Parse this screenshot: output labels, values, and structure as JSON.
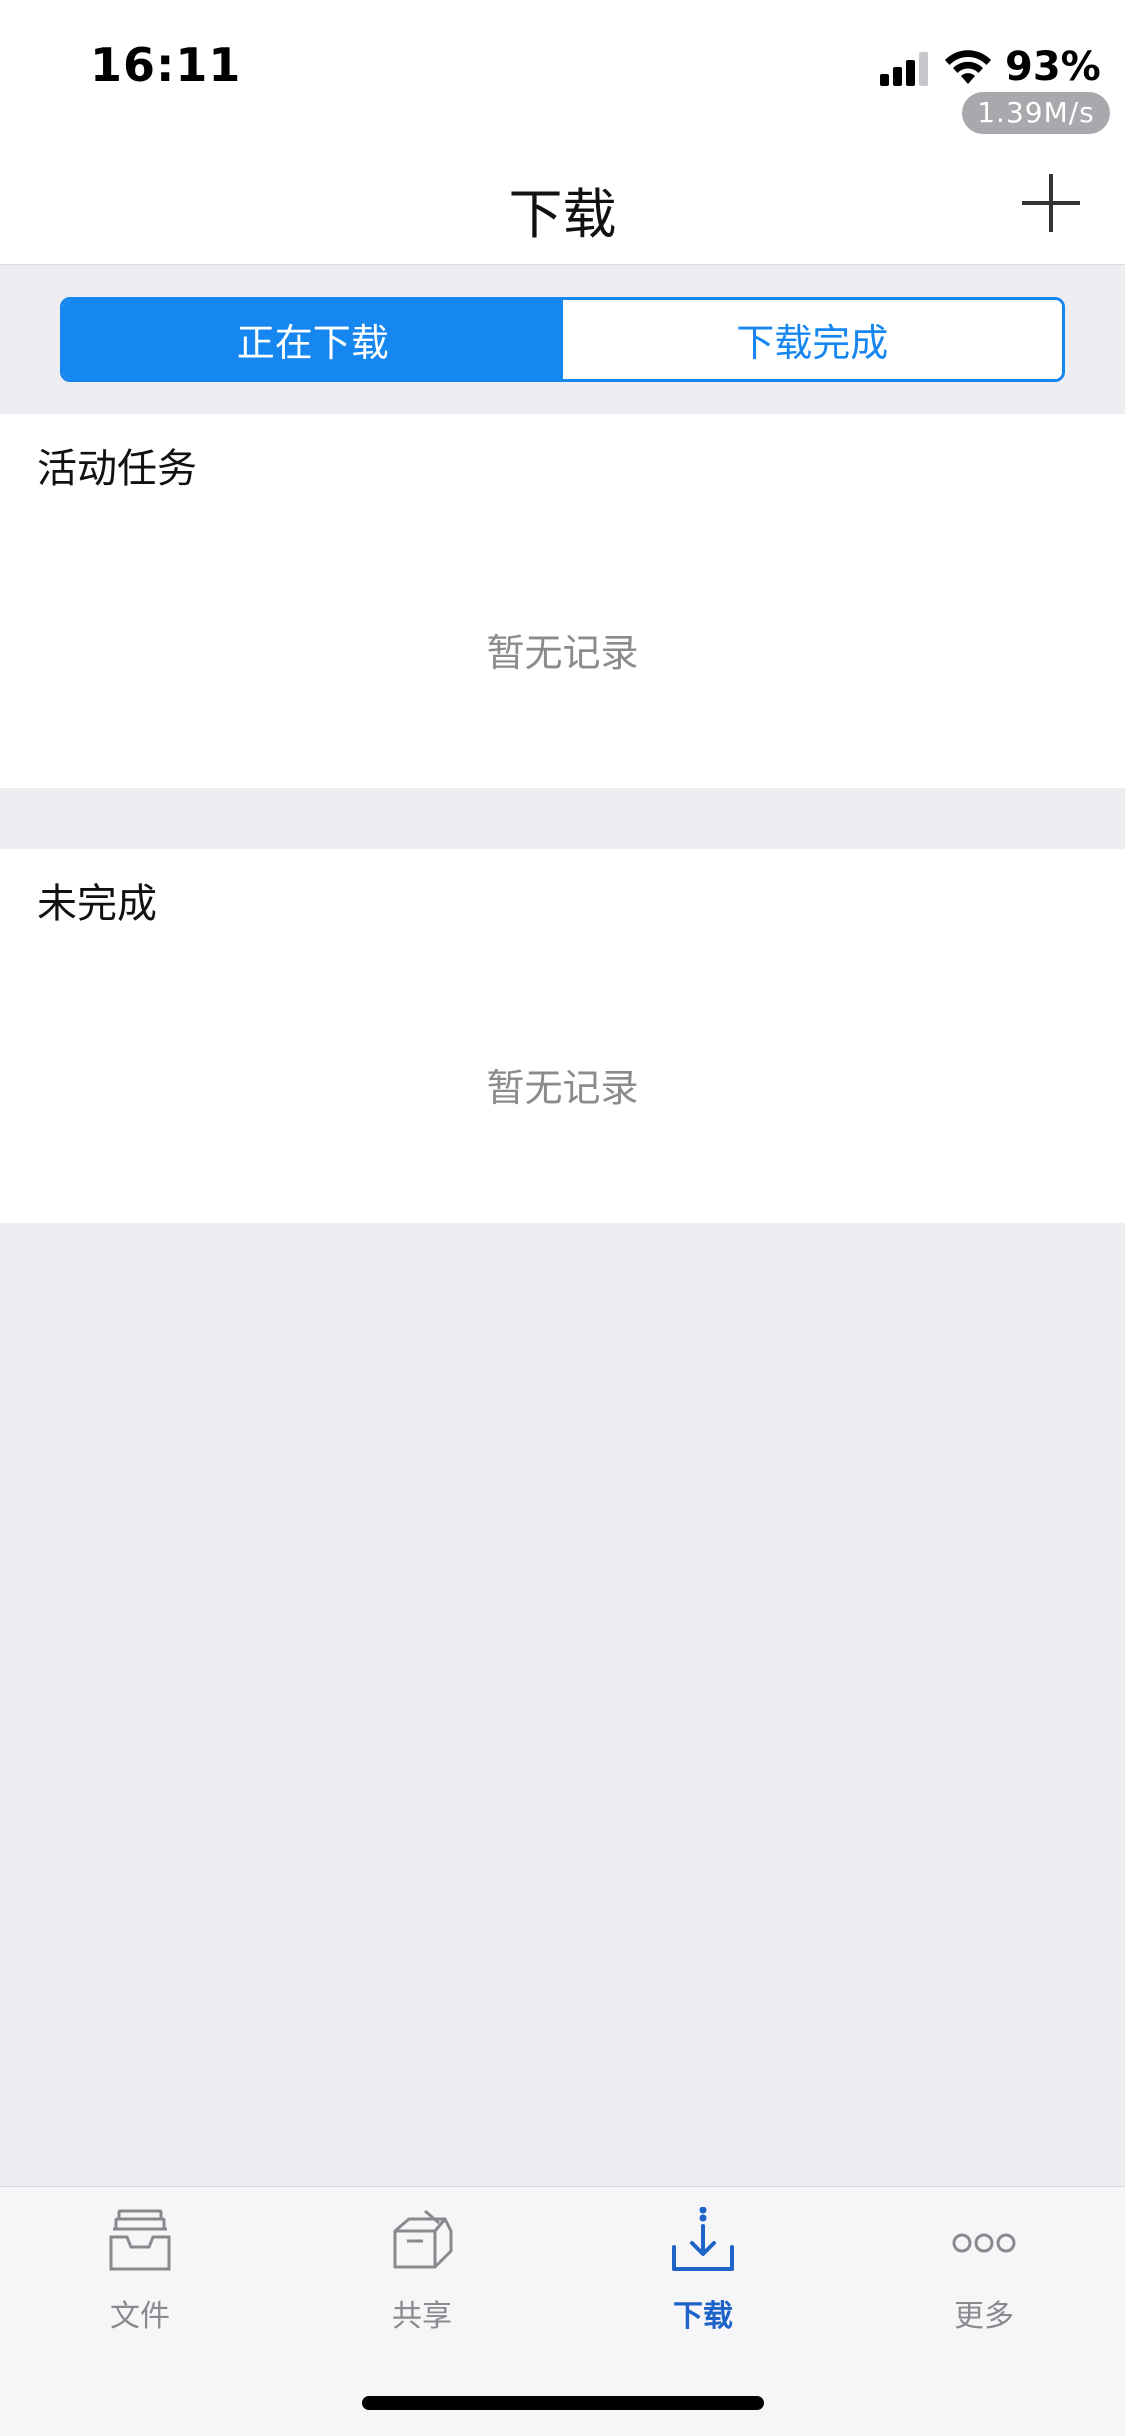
{
  "status_bar": {
    "time": "16:11",
    "battery": "93%",
    "net_speed": "1.39M/s"
  },
  "nav": {
    "title": "下载",
    "add_icon": "plus-icon"
  },
  "segment": {
    "active_label": "正在下载",
    "inactive_label": "下载完成",
    "accent_color": "#1686f0"
  },
  "sections": {
    "active": {
      "title": "活动任务",
      "empty": "暂无记录"
    },
    "incomplete": {
      "title": "未完成",
      "empty": "暂无记录"
    }
  },
  "tabbar": {
    "items": [
      {
        "label": "文件",
        "icon": "tray-icon",
        "active": false
      },
      {
        "label": "共享",
        "icon": "box-share-icon",
        "active": false
      },
      {
        "label": "下载",
        "icon": "download-icon",
        "active": true
      },
      {
        "label": "更多",
        "icon": "more-icon",
        "active": false
      }
    ],
    "active_color": "#1e63c8"
  }
}
